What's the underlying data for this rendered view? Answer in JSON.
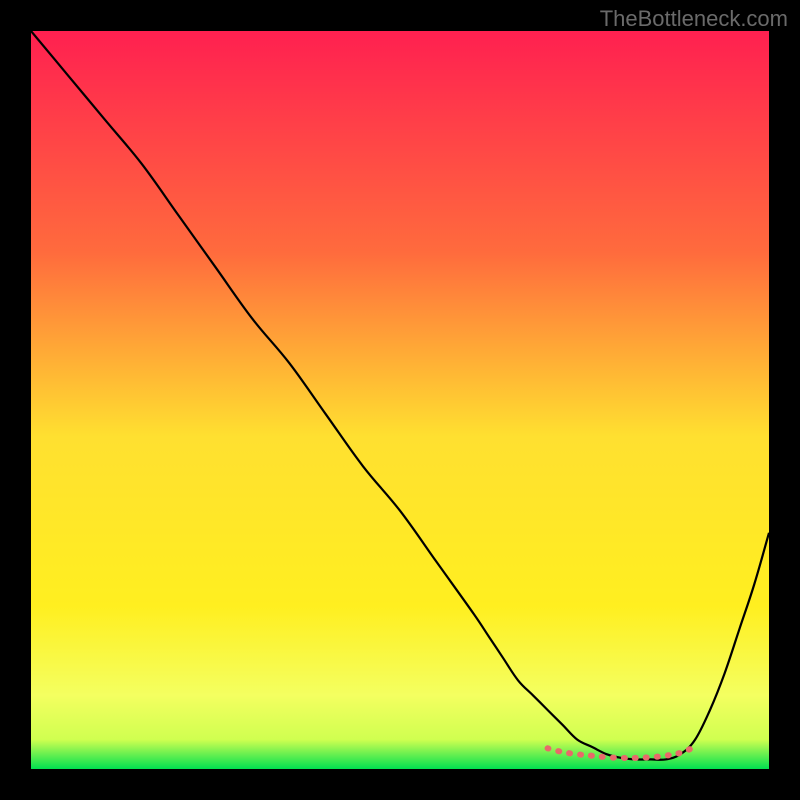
{
  "watermark": "TheBottleneck.com",
  "chart_data": {
    "type": "line",
    "title": "",
    "xlabel": "",
    "ylabel": "",
    "xlim": [
      0,
      100
    ],
    "ylim": [
      0,
      100
    ],
    "background_gradient": {
      "top": "#ff2050",
      "mid_upper": "#ff6040",
      "mid": "#ffe030",
      "mid_lower": "#ffff60",
      "bottom": "#00e050"
    },
    "series": [
      {
        "name": "primary-curve",
        "color": "#000000",
        "x": [
          0,
          5,
          10,
          15,
          20,
          25,
          30,
          35,
          40,
          45,
          50,
          55,
          60,
          62,
          64,
          66,
          68,
          70,
          72,
          74,
          76,
          78,
          80,
          82,
          84,
          86,
          88,
          90,
          92,
          94,
          96,
          98,
          100
        ],
        "y": [
          100,
          94,
          88,
          82,
          75,
          68,
          61,
          55,
          48,
          41,
          35,
          28,
          21,
          18,
          15,
          12,
          10,
          8,
          6,
          4,
          3,
          2,
          1.5,
          1.3,
          1.3,
          1.3,
          2,
          4,
          8,
          13,
          19,
          25,
          32
        ]
      },
      {
        "name": "highlight-segment",
        "color": "#e86a6a",
        "x": [
          70,
          72,
          74,
          76,
          78,
          80,
          82,
          84,
          86,
          88,
          90
        ],
        "y": [
          2.8,
          2.3,
          2.0,
          1.8,
          1.6,
          1.5,
          1.5,
          1.6,
          1.8,
          2.2,
          3.0
        ]
      }
    ]
  }
}
